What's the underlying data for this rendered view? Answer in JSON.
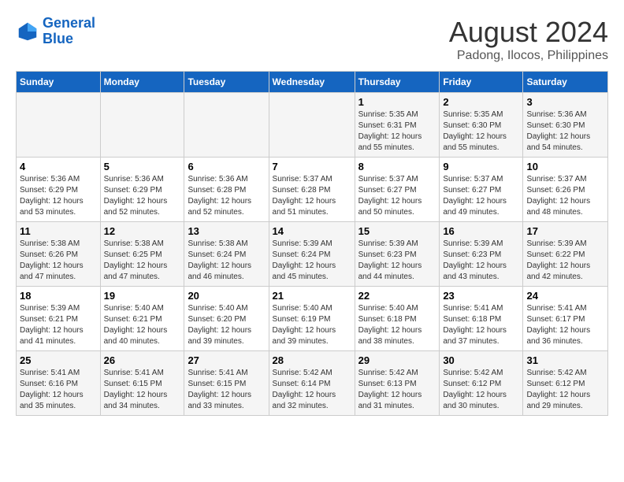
{
  "logo": {
    "line1": "General",
    "line2": "Blue"
  },
  "title": "August 2024",
  "subtitle": "Padong, Ilocos, Philippines",
  "weekdays": [
    "Sunday",
    "Monday",
    "Tuesday",
    "Wednesday",
    "Thursday",
    "Friday",
    "Saturday"
  ],
  "weeks": [
    [
      {
        "day": "",
        "info": ""
      },
      {
        "day": "",
        "info": ""
      },
      {
        "day": "",
        "info": ""
      },
      {
        "day": "",
        "info": ""
      },
      {
        "day": "1",
        "info": "Sunrise: 5:35 AM\nSunset: 6:31 PM\nDaylight: 12 hours\nand 55 minutes."
      },
      {
        "day": "2",
        "info": "Sunrise: 5:35 AM\nSunset: 6:30 PM\nDaylight: 12 hours\nand 55 minutes."
      },
      {
        "day": "3",
        "info": "Sunrise: 5:36 AM\nSunset: 6:30 PM\nDaylight: 12 hours\nand 54 minutes."
      }
    ],
    [
      {
        "day": "4",
        "info": "Sunrise: 5:36 AM\nSunset: 6:29 PM\nDaylight: 12 hours\nand 53 minutes."
      },
      {
        "day": "5",
        "info": "Sunrise: 5:36 AM\nSunset: 6:29 PM\nDaylight: 12 hours\nand 52 minutes."
      },
      {
        "day": "6",
        "info": "Sunrise: 5:36 AM\nSunset: 6:28 PM\nDaylight: 12 hours\nand 52 minutes."
      },
      {
        "day": "7",
        "info": "Sunrise: 5:37 AM\nSunset: 6:28 PM\nDaylight: 12 hours\nand 51 minutes."
      },
      {
        "day": "8",
        "info": "Sunrise: 5:37 AM\nSunset: 6:27 PM\nDaylight: 12 hours\nand 50 minutes."
      },
      {
        "day": "9",
        "info": "Sunrise: 5:37 AM\nSunset: 6:27 PM\nDaylight: 12 hours\nand 49 minutes."
      },
      {
        "day": "10",
        "info": "Sunrise: 5:37 AM\nSunset: 6:26 PM\nDaylight: 12 hours\nand 48 minutes."
      }
    ],
    [
      {
        "day": "11",
        "info": "Sunrise: 5:38 AM\nSunset: 6:26 PM\nDaylight: 12 hours\nand 47 minutes."
      },
      {
        "day": "12",
        "info": "Sunrise: 5:38 AM\nSunset: 6:25 PM\nDaylight: 12 hours\nand 47 minutes."
      },
      {
        "day": "13",
        "info": "Sunrise: 5:38 AM\nSunset: 6:24 PM\nDaylight: 12 hours\nand 46 minutes."
      },
      {
        "day": "14",
        "info": "Sunrise: 5:39 AM\nSunset: 6:24 PM\nDaylight: 12 hours\nand 45 minutes."
      },
      {
        "day": "15",
        "info": "Sunrise: 5:39 AM\nSunset: 6:23 PM\nDaylight: 12 hours\nand 44 minutes."
      },
      {
        "day": "16",
        "info": "Sunrise: 5:39 AM\nSunset: 6:23 PM\nDaylight: 12 hours\nand 43 minutes."
      },
      {
        "day": "17",
        "info": "Sunrise: 5:39 AM\nSunset: 6:22 PM\nDaylight: 12 hours\nand 42 minutes."
      }
    ],
    [
      {
        "day": "18",
        "info": "Sunrise: 5:39 AM\nSunset: 6:21 PM\nDaylight: 12 hours\nand 41 minutes."
      },
      {
        "day": "19",
        "info": "Sunrise: 5:40 AM\nSunset: 6:21 PM\nDaylight: 12 hours\nand 40 minutes."
      },
      {
        "day": "20",
        "info": "Sunrise: 5:40 AM\nSunset: 6:20 PM\nDaylight: 12 hours\nand 39 minutes."
      },
      {
        "day": "21",
        "info": "Sunrise: 5:40 AM\nSunset: 6:19 PM\nDaylight: 12 hours\nand 39 minutes."
      },
      {
        "day": "22",
        "info": "Sunrise: 5:40 AM\nSunset: 6:18 PM\nDaylight: 12 hours\nand 38 minutes."
      },
      {
        "day": "23",
        "info": "Sunrise: 5:41 AM\nSunset: 6:18 PM\nDaylight: 12 hours\nand 37 minutes."
      },
      {
        "day": "24",
        "info": "Sunrise: 5:41 AM\nSunset: 6:17 PM\nDaylight: 12 hours\nand 36 minutes."
      }
    ],
    [
      {
        "day": "25",
        "info": "Sunrise: 5:41 AM\nSunset: 6:16 PM\nDaylight: 12 hours\nand 35 minutes."
      },
      {
        "day": "26",
        "info": "Sunrise: 5:41 AM\nSunset: 6:15 PM\nDaylight: 12 hours\nand 34 minutes."
      },
      {
        "day": "27",
        "info": "Sunrise: 5:41 AM\nSunset: 6:15 PM\nDaylight: 12 hours\nand 33 minutes."
      },
      {
        "day": "28",
        "info": "Sunrise: 5:42 AM\nSunset: 6:14 PM\nDaylight: 12 hours\nand 32 minutes."
      },
      {
        "day": "29",
        "info": "Sunrise: 5:42 AM\nSunset: 6:13 PM\nDaylight: 12 hours\nand 31 minutes."
      },
      {
        "day": "30",
        "info": "Sunrise: 5:42 AM\nSunset: 6:12 PM\nDaylight: 12 hours\nand 30 minutes."
      },
      {
        "day": "31",
        "info": "Sunrise: 5:42 AM\nSunset: 6:12 PM\nDaylight: 12 hours\nand 29 minutes."
      }
    ]
  ]
}
